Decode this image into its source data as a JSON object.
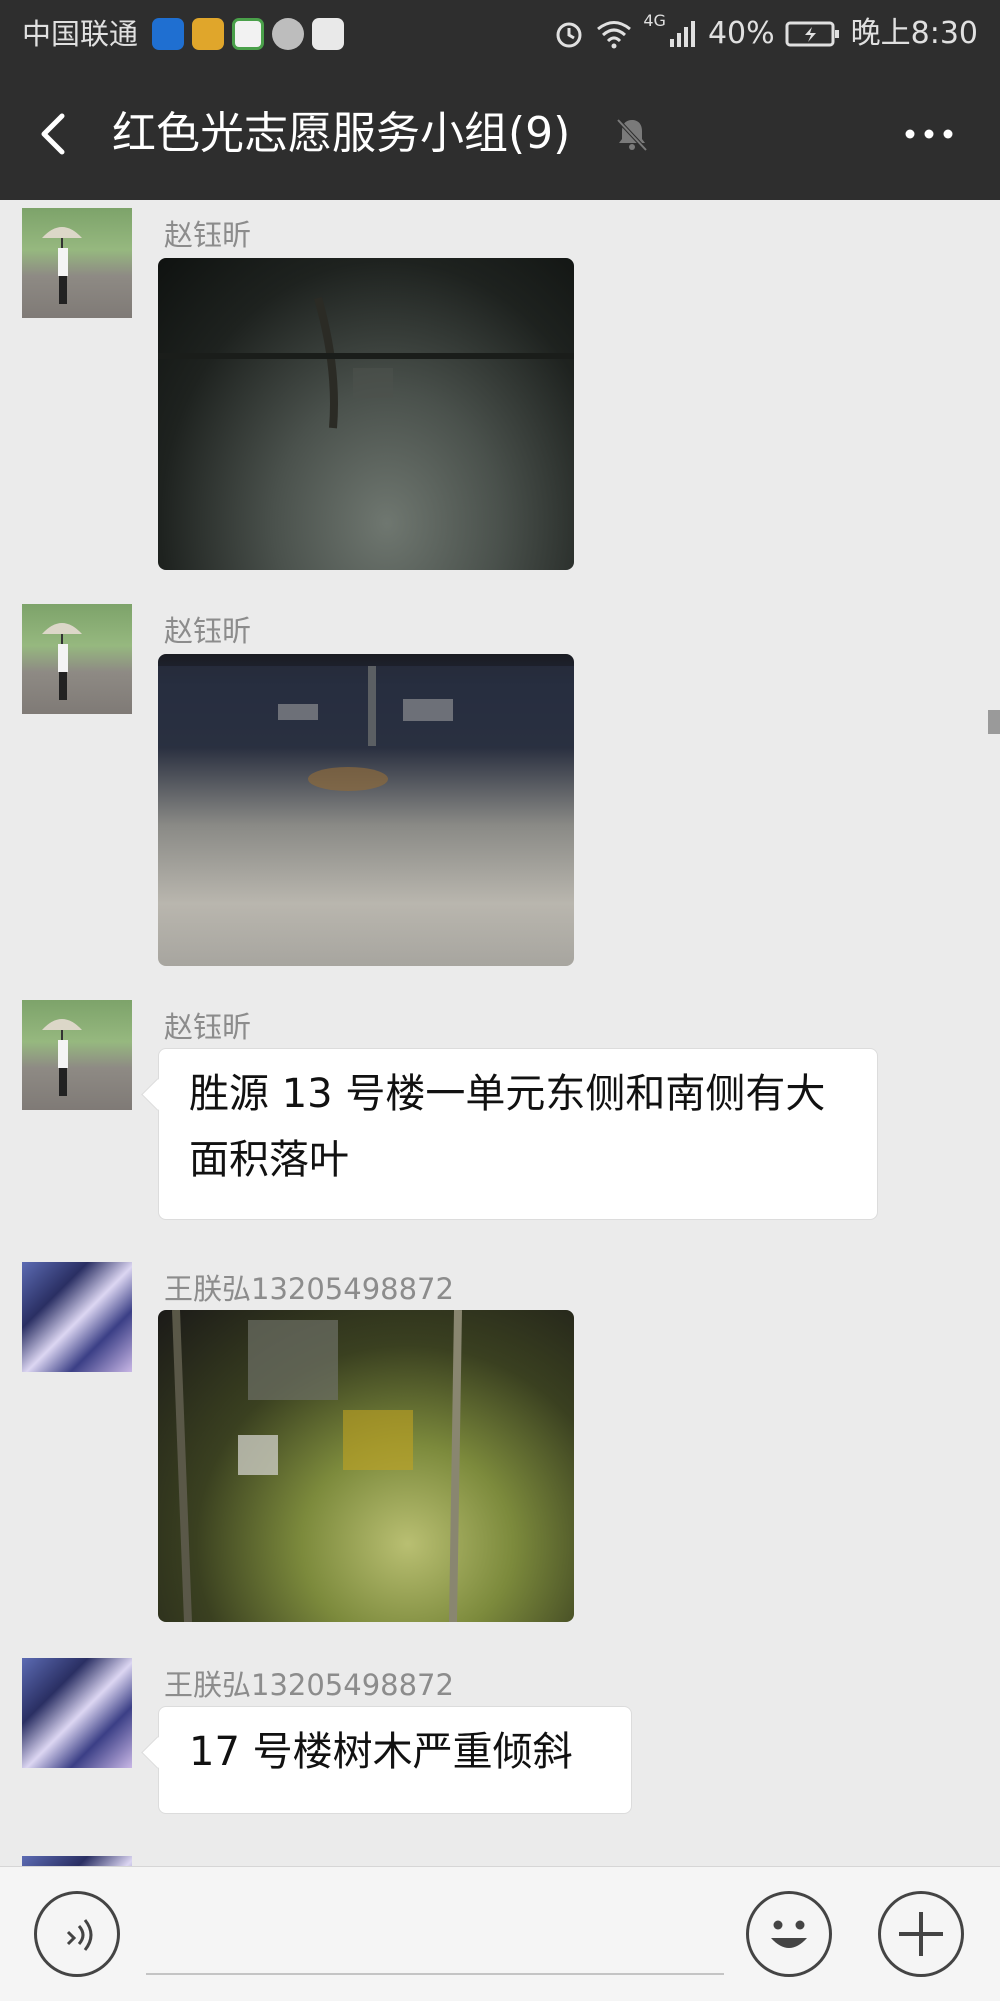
{
  "status_bar": {
    "carrier": "中国联通",
    "battery": "40%",
    "network": "4G",
    "time": "晚上8:30",
    "app_icons": [
      "shield-app-icon",
      "news-app-icon",
      "browser-app-icon",
      "huawei-icon",
      "video-app-icon"
    ]
  },
  "header": {
    "title": "红色光志愿服务小组(9)",
    "back_icon": "chevron-left-icon",
    "mute_icon": "muted-bell-icon",
    "more_icon": "more-dots-icon"
  },
  "messages": [
    {
      "sender": "赵钰昕",
      "type": "image",
      "avatar": "umbrella-person-avatar"
    },
    {
      "sender": "赵钰昕",
      "type": "image",
      "avatar": "umbrella-person-avatar"
    },
    {
      "sender": "赵钰昕",
      "type": "text",
      "text": "胜源 13 号楼一单元东侧和南侧有大面积落叶",
      "avatar": "umbrella-person-avatar"
    },
    {
      "sender": "王朕弘13205498872",
      "type": "image",
      "avatar": "anime-avatar"
    },
    {
      "sender": "王朕弘13205498872",
      "type": "text",
      "text": "17 号楼树木严重倾斜",
      "avatar": "anime-avatar"
    }
  ],
  "input_bar": {
    "voice_icon": "voice-icon",
    "emoji_icon": "emoji-icon",
    "plus_icon": "plus-icon",
    "text_value": ""
  },
  "colors": {
    "header_bg": "#2e2e2e",
    "chat_bg": "#ebebeb",
    "bubble_bg": "#ffffff",
    "sender_text": "#8c8c8c"
  }
}
